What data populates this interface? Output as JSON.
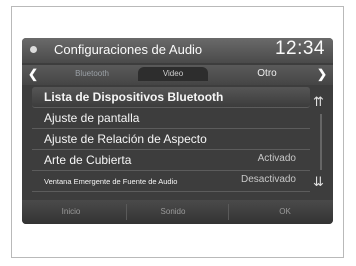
{
  "header": {
    "title": "Configuraciones de Audio",
    "clock": "12:34"
  },
  "tabs": [
    {
      "label": "Bluetooth",
      "active": false
    },
    {
      "label": "Video",
      "active": true
    },
    {
      "label": "Otro",
      "active": false
    }
  ],
  "list": [
    {
      "label": "Lista de Dispositivos Bluetooth",
      "value": ""
    },
    {
      "label": "Ajuste de pantalla",
      "value": ""
    },
    {
      "label": "Ajuste de Relación de Aspecto",
      "value": ""
    },
    {
      "label": "Arte de Cubierta",
      "value": "Activado"
    },
    {
      "label": "Ventana Emergente de Fuente de Audio",
      "value": "Desactivado"
    }
  ],
  "footer": {
    "btn1": "Inicio",
    "btn2": "Sonido",
    "btn3": "OK"
  }
}
